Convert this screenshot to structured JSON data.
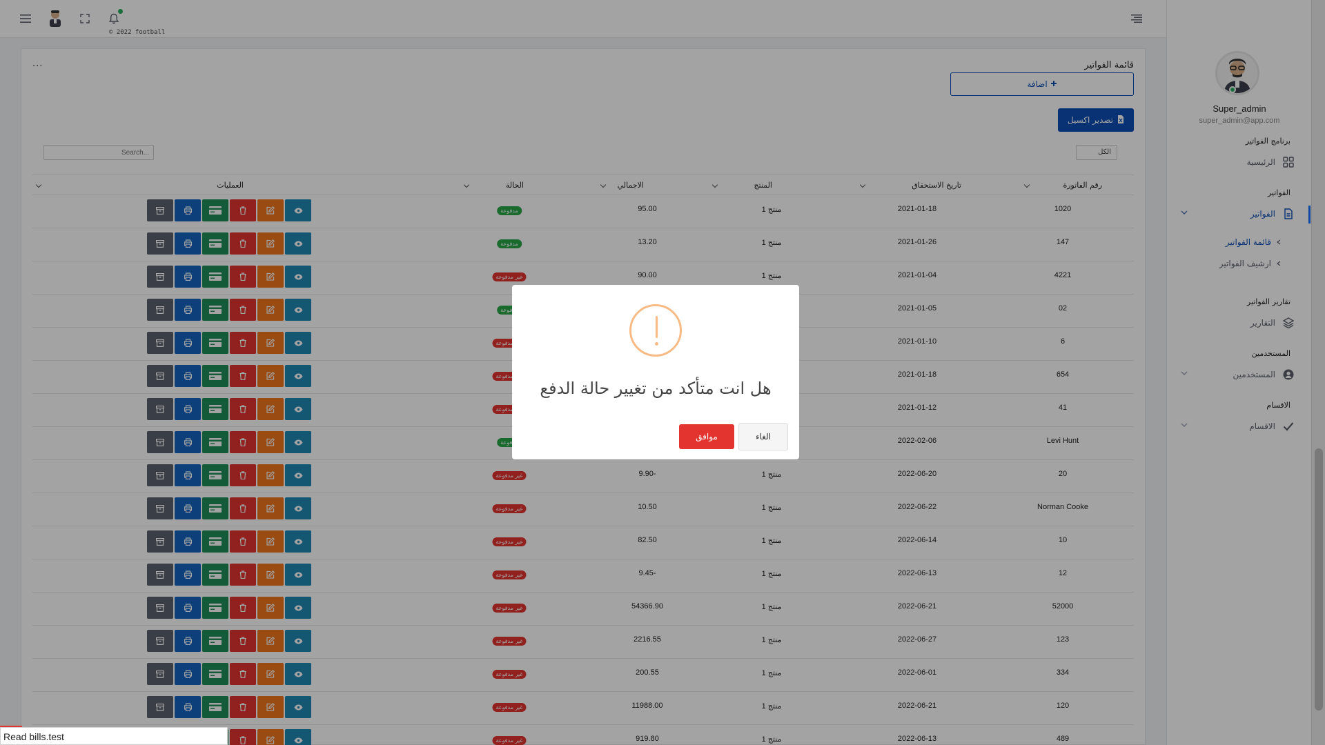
{
  "topbar": {
    "copyright": "© 2022 football"
  },
  "sidebar": {
    "user_name": "Super_admin",
    "user_email": "super_admin@app.com",
    "sections": [
      {
        "category": "برنامج الفواتير",
        "item": "الرئيسية"
      },
      {
        "category": "الفواتير",
        "item": "الفواتير"
      },
      {
        "category": "تقارير الفواتير",
        "item": "التقارير"
      },
      {
        "category": "المستخدمين",
        "item": "المستخدمين"
      },
      {
        "category": "الاقسام",
        "item": "الاقسام"
      }
    ],
    "submenu": [
      "قائمة الفواتير",
      "ارشيف الفواتير"
    ]
  },
  "card": {
    "title": "قائمة الفواتير",
    "dots": "...",
    "add_button": "اضافة",
    "export_button": "تصدير اكسيل",
    "filter_value": "الكل",
    "search_placeholder": "Search..."
  },
  "table": {
    "headers": {
      "invoice_no": "رقم الفاتورة",
      "due_date": "تاريخ الاستحقاق",
      "product": "المنتج",
      "total": "الاجمالي",
      "status": "الحالة",
      "actions": "العمليات"
    },
    "rows": [
      {
        "invoice_no": "1020",
        "due_date": "2021-01-18",
        "product": "منتج 1",
        "total": "95.00",
        "status": "مدفوعة",
        "paid": true
      },
      {
        "invoice_no": "147",
        "due_date": "2021-01-26",
        "product": "منتج 1",
        "total": "13.20",
        "status": "مدفوعة",
        "paid": true
      },
      {
        "invoice_no": "4221",
        "due_date": "2021-01-04",
        "product": "منتج 1",
        "total": "90.00",
        "status": "غير مدفوعة",
        "paid": false
      },
      {
        "invoice_no": "02",
        "due_date": "2021-01-05",
        "product": "",
        "total": "",
        "status": "مدفوعة",
        "paid": true
      },
      {
        "invoice_no": "6",
        "due_date": "2021-01-10",
        "product": "",
        "total": "",
        "status": "غير مدفوعة",
        "paid": false
      },
      {
        "invoice_no": "654",
        "due_date": "2021-01-18",
        "product": "",
        "total": "",
        "status": "غير مدفوعة",
        "paid": false
      },
      {
        "invoice_no": "41",
        "due_date": "2021-01-12",
        "product": "",
        "total": "",
        "status": "غير مدفوعة",
        "paid": false
      },
      {
        "invoice_no": "Levi Hunt",
        "due_date": "2022-02-06",
        "product": "",
        "total": "",
        "status": "مدفوعة",
        "paid": true
      },
      {
        "invoice_no": "20",
        "due_date": "2022-06-20",
        "product": "منتج 1",
        "total": "9.90-",
        "status": "غير مدفوعة",
        "paid": false
      },
      {
        "invoice_no": "Norman Cooke",
        "due_date": "2022-06-22",
        "product": "منتج 1",
        "total": "10.50",
        "status": "غير مدفوعة",
        "paid": false
      },
      {
        "invoice_no": "10",
        "due_date": "2022-06-14",
        "product": "منتج 1",
        "total": "82.50",
        "status": "غير مدفوعة",
        "paid": false
      },
      {
        "invoice_no": "12",
        "due_date": "2022-06-13",
        "product": "منتج 1",
        "total": "9.45-",
        "status": "غير مدفوعة",
        "paid": false
      },
      {
        "invoice_no": "52000",
        "due_date": "2022-06-21",
        "product": "منتج 1",
        "total": "54366.90",
        "status": "غير مدفوعة",
        "paid": false
      },
      {
        "invoice_no": "123",
        "due_date": "2022-06-27",
        "product": "منتج 1",
        "total": "2216.55",
        "status": "غير مدفوعة",
        "paid": false
      },
      {
        "invoice_no": "334",
        "due_date": "2022-06-01",
        "product": "منتج 1",
        "total": "200.55",
        "status": "غير مدفوعة",
        "paid": false
      },
      {
        "invoice_no": "120",
        "due_date": "2022-06-21",
        "product": "منتج 1",
        "total": "11988.00",
        "status": "غير مدفوعة",
        "paid": false
      },
      {
        "invoice_no": "489",
        "due_date": "2022-06-13",
        "product": "منتج 1",
        "total": "919.80",
        "status": "غير مدفوعة",
        "paid": false
      }
    ]
  },
  "modal": {
    "title": "هل انت متأكد من تغيير حالة الدفع",
    "confirm": "موافق",
    "cancel": "الغاء"
  },
  "statusbar": {
    "text": "Read bills.test"
  },
  "colors": {
    "primary": "#0d4fb5",
    "paid_badge": "#28a745",
    "unpaid_badge": "#e3342f",
    "warning": "#f8bb86",
    "confirm": "#e3342f",
    "action_archive": "#5a6270",
    "action_print": "#1565c0",
    "action_payment": "#1e8e5a",
    "action_delete": "#e3342f",
    "action_edit": "#f0761c",
    "action_view": "#1e88b4"
  }
}
